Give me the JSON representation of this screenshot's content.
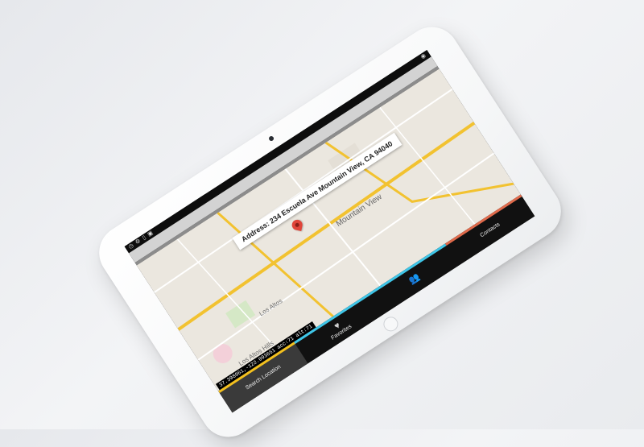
{
  "map": {
    "address": "Address: 234 Escuela Ave Mountain View, CA 94040",
    "labels": {
      "city": "Mountain View",
      "los_altos": "Los Altos",
      "los_altos_hills": "Los Altos Hills"
    },
    "coords": "37.398961,-122.093651 acc:71 alt:71"
  },
  "nav": {
    "search_label": "Search Location",
    "favorites_label": "Favorites",
    "contacts_label": "Contacts",
    "colors": {
      "search": "#f3c01e",
      "favorites": "#3fc6e8",
      "contacts": "#e06a4b"
    }
  },
  "icons": {
    "status": [
      "clock-icon",
      "gear-icon",
      "phone-icon",
      "photo-icon"
    ],
    "status_right": "location-icon",
    "favorites": "heart-icon",
    "contacts": "people-icon"
  }
}
